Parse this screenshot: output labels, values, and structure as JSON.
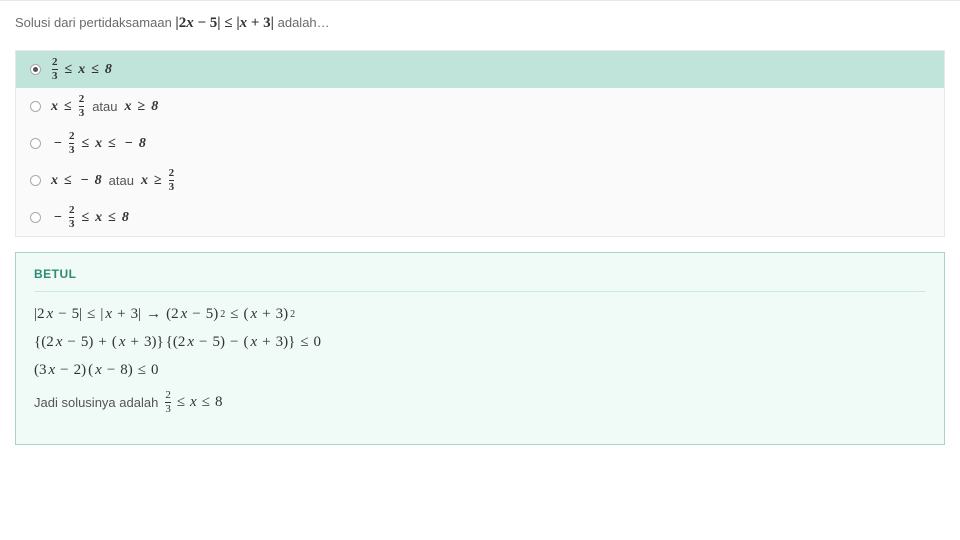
{
  "question": {
    "prefix": "Solusi dari pertidaksamaan ",
    "math": "|2x − 5| ≤ |x + 3|",
    "suffix": " adalah…"
  },
  "options": [
    {
      "selected": true,
      "html": "frac23 ≤ x ≤ 8"
    },
    {
      "selected": false,
      "html": "x ≤ frac23 atau x ≥ 8"
    },
    {
      "selected": false,
      "html": "−frac23 ≤ x ≤ −8"
    },
    {
      "selected": false,
      "html": "x ≤ −8 atau x ≥ frac23"
    },
    {
      "selected": false,
      "html": "−frac23 ≤ x ≤ 8"
    }
  ],
  "answer": {
    "label": "BETUL",
    "lines": [
      "|2x − 5| ≤ |x + 3| → (2x − 5)² ≤ (x + 3)²",
      "{(2x − 5) + (x + 3)} {(2x − 5) − (x + 3)} ≤ 0",
      "(3x − 2) (x − 8) ≤ 0"
    ],
    "final_prefix": "Jadi solusinya adalah ",
    "final_math": "frac23 ≤ x ≤ 8"
  },
  "chart_data": {
    "type": "table",
    "description": "Multiple-choice math question with worked solution",
    "question_latex": "|2x-5| \\le |x+3|",
    "choices": [
      "2/3 ≤ x ≤ 8",
      "x ≤ 2/3 atau x ≥ 8",
      "-2/3 ≤ x ≤ -8",
      "x ≤ -8 atau x ≥ 2/3",
      "-2/3 ≤ x ≤ 8"
    ],
    "correct_index": 0,
    "solution_steps": [
      "|2x-5| ≤ |x+3| → (2x-5)^2 ≤ (x+3)^2",
      "{(2x-5)+(x+3)}{(2x-5)-(x+3)} ≤ 0",
      "(3x-2)(x-8) ≤ 0",
      "Jadi solusinya adalah 2/3 ≤ x ≤ 8"
    ]
  }
}
